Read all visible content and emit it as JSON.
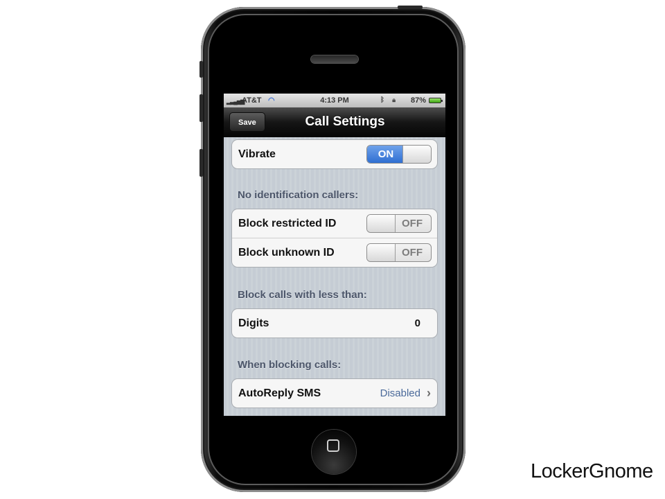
{
  "status_bar": {
    "carrier": "AT&T",
    "time": "4:13 PM",
    "battery_percent": "87%"
  },
  "nav": {
    "save_label": "Save",
    "title": "Call Settings"
  },
  "settings": {
    "vibrate": {
      "label": "Vibrate",
      "state": "ON"
    },
    "no_id_header": "No identification callers:",
    "block_restricted": {
      "label": "Block restricted ID",
      "state": "OFF"
    },
    "block_unknown": {
      "label": "Block unknown ID",
      "state": "OFF"
    },
    "block_less_header": "Block calls with less than:",
    "digits": {
      "label": "Digits",
      "value": "0"
    },
    "when_blocking_header": "When blocking calls:",
    "autoreply": {
      "label": "AutoReply SMS",
      "value": "Disabled"
    }
  },
  "brand": "LockerGnome",
  "icons": {
    "wifi": "wifi-icon",
    "signal": "signal-bars-icon",
    "battery": "battery-icon",
    "chevron": "chevron-right-icon",
    "home": "home-button-icon"
  },
  "colors": {
    "toggle_on": "#2f6fd2",
    "nav_bar": "#161616",
    "table_background": "#c5ccd4",
    "header_text": "#4c566a"
  }
}
